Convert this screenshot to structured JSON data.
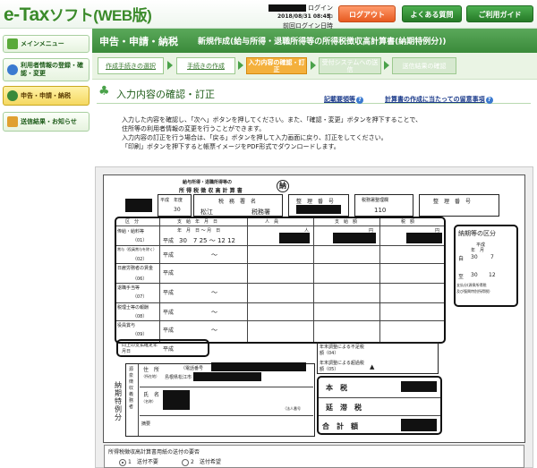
{
  "header": {
    "logo_main": "e-Tax",
    "logo_sub": "ソフト(WEB版)",
    "login_suffix": "ログイン中",
    "last_login_label": "前回ログイン日時",
    "last_login_value": "2018/08/31 08:45",
    "logout": "ログアウト",
    "faq": "よくある質問",
    "guide": "ご利用ガイド"
  },
  "nav": {
    "items": [
      {
        "label": "メインメニュー"
      },
      {
        "label": "利用者情報の登録・確認・変更"
      },
      {
        "label": "申告・申請・納税"
      },
      {
        "label": "送信結果・お知らせ"
      }
    ]
  },
  "main": {
    "section": "申告・申請・納税",
    "subtitle": "新規作成(給与所得・退職所得等の所得税徴収高計算書(納期特例分))",
    "steps": [
      {
        "label": "作成手続きの選択"
      },
      {
        "label": "手続きの作成"
      },
      {
        "label": "入力内容の確認・訂正"
      },
      {
        "label": "受付システムへの送信"
      },
      {
        "label": "送信結果の確認"
      }
    ],
    "heading": "入力内容の確認・訂正",
    "link_example": "記載要領等",
    "link_notes": "計算書の作成に当たっての留意事項",
    "instructions": [
      "入力した内容を確認し、「次へ」ボタンを押してください。また、「確認・変更」ボタンを押下することで、",
      "住所等の利用者情報の変更を行うことができます。",
      "入力内容の訂正を行う場合は、「戻る」ボタンを押して入力画面に戻り、訂正をしてください。",
      "「印刷」ボタンを押下すると帳票イメージをPDF形式でダウンロードします。"
    ]
  },
  "form": {
    "title_line1": "給与所得・退職所得等の",
    "title_line2": "所 得 税 徴 収 高 計 算 書",
    "seal": "納",
    "heisei_nendo_label": "平成　年度",
    "nendo_value": "30",
    "tax_office_label": "税　務　署　名",
    "tax_office_value": "松江",
    "tax_office_suffix": "税務署",
    "seiri_label": "整　理　番　号",
    "reference_label": "税務署整理欄",
    "reference_value": "110",
    "col_kubun": "区　分",
    "col_period": "支　給　年　月　日",
    "col_people": "人　員",
    "col_amount": "支　給　額",
    "col_tax": "税　額",
    "nin": "人",
    "yen": "円",
    "date_header": "年　月　日 ～ 月　日",
    "rows": [
      {
        "label": "俸給・給料等",
        "code": "（01）",
        "era": "平成",
        "dates": "30　7 25 ～ 12 12"
      },
      {
        "label": "賞与（役員賞与を除く）",
        "code": "（02）",
        "era": "平成",
        "dates": "～"
      },
      {
        "label": "日雇労務者の賃金",
        "code": "（06）",
        "era": "平成",
        "dates": ""
      },
      {
        "label": "退職手当等",
        "code": "（07）",
        "era": "平成",
        "dates": "～"
      },
      {
        "label": "税理士等の報酬",
        "code": "（08）",
        "era": "平成",
        "dates": "～"
      },
      {
        "label": "役員賞与",
        "code": "（09）",
        "era": "平成",
        "dates": "～"
      },
      {
        "label": "同上の支払確定年月日",
        "code": "",
        "era": "平成",
        "dates": ""
      }
    ],
    "period_box_title": "納期等の区分",
    "period_heisei": "平成",
    "period_year_month": "年　月",
    "period_from_label": "自",
    "period_from_year": "30",
    "period_from_month": "7",
    "period_to_label": "至",
    "period_to_year": "30",
    "period_to_month": "12",
    "period_note1": "支払分(源泉所得税",
    "period_note2": "及び復興特別所得税)",
    "year_end_short": "年末調整による不足税額（04）",
    "year_end_excess": "年末調整による超過税額（05）",
    "honzei": "本　税",
    "entaizei": "延　滞　税",
    "gokei": "合　計　額",
    "kanji_side": "納期特例分",
    "payer_side": "源泉徴収義務者",
    "address_label": "住　所",
    "address_sub": "（所在地）",
    "phone_label": "（電話番号",
    "address_value": "島根県松江市",
    "name_label": "氏　名",
    "name_sub": "（名称）",
    "corp_note": "（法人番号",
    "summary_label": "摘要",
    "delivery_title": "所得税徴収高計算書用紙の送付の要否",
    "option1": "1　送付不要",
    "option2": "2　送付希望"
  }
}
